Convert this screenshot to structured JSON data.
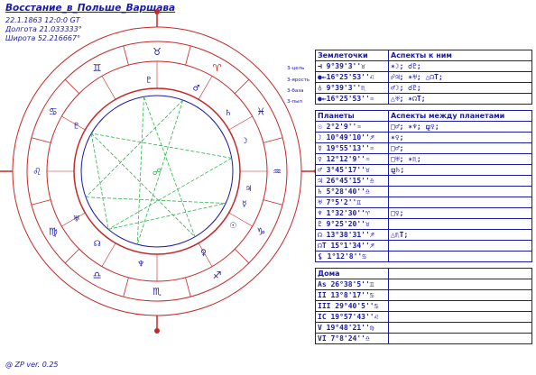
{
  "header": {
    "title": "Восстание_в_Польше_Варшава",
    "datetime": "22.1.1863 12:0:0 GT",
    "longitude": "Долгота 21.033333°",
    "latitude": "Широта 52.216667°"
  },
  "footer": "@ ZP  ver. 0.25",
  "levels": [
    "3-цель",
    "3-ярость",
    "3-база",
    "3-пыл"
  ],
  "colors": {
    "text": "#1a1aa6",
    "circle": "#c62828",
    "aspect_green": "#2bb34a",
    "sign_red": "#c62828"
  },
  "wheel": {
    "signs": [
      "♈",
      "♉",
      "♊",
      "♋",
      "♌",
      "♍",
      "♎",
      "♏",
      "♐",
      "♑",
      "♒",
      "♓"
    ],
    "house_numbers": [
      "1",
      "2",
      "3",
      "4",
      "5",
      "6",
      "7",
      "8",
      "9",
      "10",
      "11",
      "12"
    ],
    "planet_glyphs": [
      "♇",
      "♂",
      "♄",
      "☽",
      "♃",
      "☿",
      "☉",
      "♀",
      "♆",
      "☊",
      "♅",
      "♇"
    ]
  },
  "table": {
    "sec1_head": [
      "Землеточки",
      "Аспекты к ним"
    ],
    "sec1_rows": [
      [
        "⊣ 9°39'3''♉",
        "✶☽; ☌♇;"
      ],
      [
        "●←16°25'53''♌",
        "☍♃; ✶♅; △☊T;"
      ],
      [
        "♁ 9°39'3''♏",
        "♂☽; ☌♇;"
      ],
      [
        "●←16°25'53''♒",
        "△♅; ✶☊T;"
      ]
    ],
    "sec2_head": [
      "Планеты",
      "Аспекты между планетами"
    ],
    "sec2_rows": [
      [
        "☉ 2°2'9''♒",
        "□♂; ✶♆; ⚼♀;"
      ],
      [
        "☽ 10°49'10''♐",
        "✶♀;"
      ],
      [
        "☿ 19°55'13''♒",
        "□♂;"
      ],
      [
        "♀ 12°12'9''♒",
        "□♅; ✶♏;"
      ],
      [
        "♂ 3°45'17''♉",
        "⚼♄;"
      ],
      [
        "♃ 26°45'15''♎",
        ""
      ],
      [
        "♄ 5°28'40''♎",
        ""
      ],
      [
        "♅ 7°5'2''♊",
        ""
      ],
      [
        "♆ 1°32'30''♈",
        "□♀;"
      ],
      [
        "♇ 9°25'20''♉",
        ""
      ],
      [
        "☊ 13°38'31''♐",
        "△♏T;"
      ],
      [
        "☊T 15°1'34''♐",
        ""
      ],
      [
        "⚸ 1°12'8''♋",
        ""
      ]
    ],
    "sec3_head": "Дома",
    "sec3_rows": [
      "As 26°38'5''♊",
      "II 13°8'17''♋",
      "III 29°40'5''♋",
      "IC 19°57'43''♌",
      "V 19°48'21''♍",
      "VI 7°8'24''♎"
    ]
  }
}
